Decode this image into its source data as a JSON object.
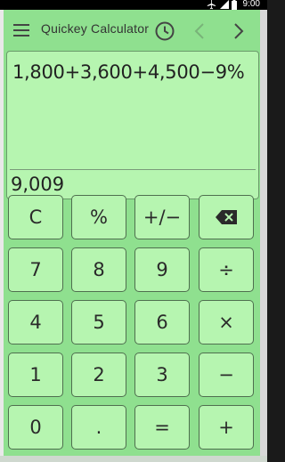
{
  "status_bar": {
    "time": "9:00"
  },
  "toolbar": {
    "title": "Quickey Calculator",
    "menu_icon": "hamburger-menu-icon",
    "history_icon": "clock-history-icon",
    "back_icon": "chevron-left-icon",
    "forward_icon": "chevron-right-icon"
  },
  "display": {
    "expression": "1,800+3,600+4,500−9%",
    "result": "9,009"
  },
  "keypad": {
    "rows": [
      [
        "C",
        "%",
        "+/−",
        "⌫"
      ],
      [
        "7",
        "8",
        "9",
        "÷"
      ],
      [
        "4",
        "5",
        "6",
        "×"
      ],
      [
        "1",
        "2",
        "3",
        "−"
      ],
      [
        "0",
        ".",
        "=",
        "+"
      ]
    ]
  },
  "colors": {
    "app_background": "#8fe08f",
    "key_background": "#b6f5b0",
    "text": "#2a2a2a"
  }
}
